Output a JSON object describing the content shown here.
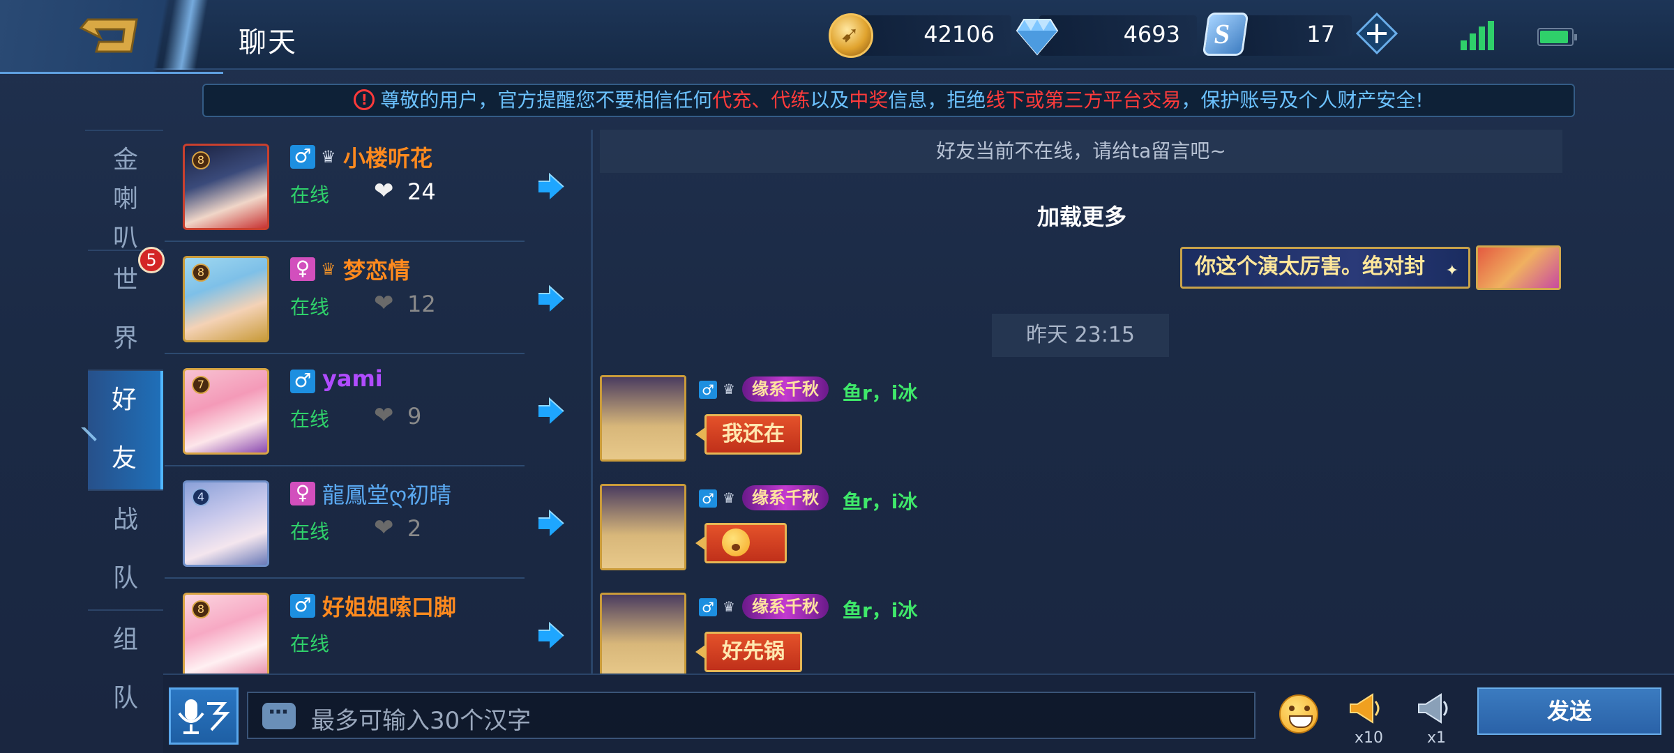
{
  "header": {
    "title": "聊天",
    "gold": "42106",
    "diamonds": "4693",
    "tickets": "17"
  },
  "notice": {
    "p1": "尊敬的用户，官方提醒您不要相信任何",
    "r1": "代充、代练",
    "p2": "以及",
    "r2": "中奖",
    "p3": "信息，拒绝",
    "r3": "线下或第三方平台交易",
    "p4": "，保护账号及个人财产安全!"
  },
  "tabs": [
    {
      "label": "金喇叭",
      "chars": [
        "金",
        "喇",
        "叭"
      ]
    },
    {
      "label": "世界",
      "chars": [
        "世",
        "界"
      ],
      "badge": "5"
    },
    {
      "label": "好友",
      "chars": [
        "好",
        "友"
      ]
    },
    {
      "label": "战队",
      "chars": [
        "战",
        "队"
      ]
    },
    {
      "label": "组队",
      "chars": [
        "组",
        "队"
      ]
    }
  ],
  "friends": [
    {
      "name": "小楼听花",
      "gender": "♂",
      "status": "在线",
      "hearts": "24",
      "level": "8",
      "name_color": "#ff8a1e"
    },
    {
      "name": "梦恋情",
      "gender": "♀",
      "status": "在线",
      "hearts": "12",
      "level": "8",
      "name_color": "#ff8a1e"
    },
    {
      "name": "yami",
      "gender": "♂",
      "status": "在线",
      "hearts": "9",
      "level": "7",
      "name_color": "#b04cff"
    },
    {
      "name": "龍鳳堂ღ初晴",
      "gender": "♀",
      "status": "在线",
      "hearts": "2",
      "level": "4",
      "name_color": "#5aa8f0"
    },
    {
      "name": "好姐姐嗦口脚",
      "gender": "♂",
      "status": "在线",
      "level": "8",
      "name_color": "#ff8a1e"
    }
  ],
  "chat": {
    "offline_notice": "好友当前不在线，请给ta留言吧~",
    "load_more": "加载更多",
    "my_message": "你这个演太厉害。绝对封",
    "timestamp": "昨天 23:15",
    "messages": [
      {
        "tag": "缘系千秋",
        "name": "鱼r，i冰",
        "text": "我还在"
      },
      {
        "tag": "缘系千秋",
        "name": "鱼r，i冰",
        "text": ""
      },
      {
        "tag": "缘系千秋",
        "name": "鱼r，i冰",
        "text": "好先锅"
      }
    ]
  },
  "input": {
    "placeholder": "最多可输入30个汉字",
    "horn_big_count": "x10",
    "horn_small_count": "x1",
    "send_label": "发送"
  },
  "colors": {
    "accent": "#1d8fe0",
    "online": "#2fd06a",
    "warning": "#ff3b3b",
    "notice_text": "#6cc2ff"
  }
}
